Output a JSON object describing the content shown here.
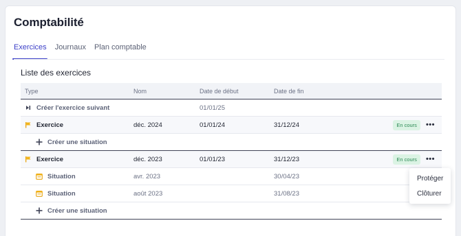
{
  "page": {
    "title": "Comptabilité"
  },
  "tabs": [
    {
      "label": "Exercices",
      "active": true
    },
    {
      "label": "Journaux",
      "active": false
    },
    {
      "label": "Plan comptable",
      "active": false
    }
  ],
  "section": {
    "title": "Liste des exercices"
  },
  "table": {
    "headers": {
      "type": "Type",
      "nom": "Nom",
      "debut": "Date de début",
      "fin": "Date de fin"
    },
    "next_row": {
      "label": "Créer l'exercice suivant",
      "debut": "01/01/25"
    },
    "exercices": [
      {
        "type": "Exercice",
        "nom": "déc. 2024",
        "debut": "01/01/24",
        "fin": "31/12/24",
        "status": "En cours",
        "situations": [],
        "create_label": "Créer une situation"
      },
      {
        "type": "Exercice",
        "nom": "déc. 2023",
        "debut": "01/01/23",
        "fin": "31/12/23",
        "status": "En cours",
        "situations": [
          {
            "type": "Situation",
            "nom": "avr. 2023",
            "fin": "30/04/23"
          },
          {
            "type": "Situation",
            "nom": "août 2023",
            "fin": "31/08/23"
          }
        ],
        "create_label": "Créer une situation"
      }
    ]
  },
  "context_menu": {
    "items": [
      "Protéger",
      "Clôturer"
    ]
  },
  "colors": {
    "accent": "#3b3fc7",
    "flag": "#f2b51c",
    "badge_bg": "#dbf3e4",
    "badge_text": "#2c8a55"
  }
}
